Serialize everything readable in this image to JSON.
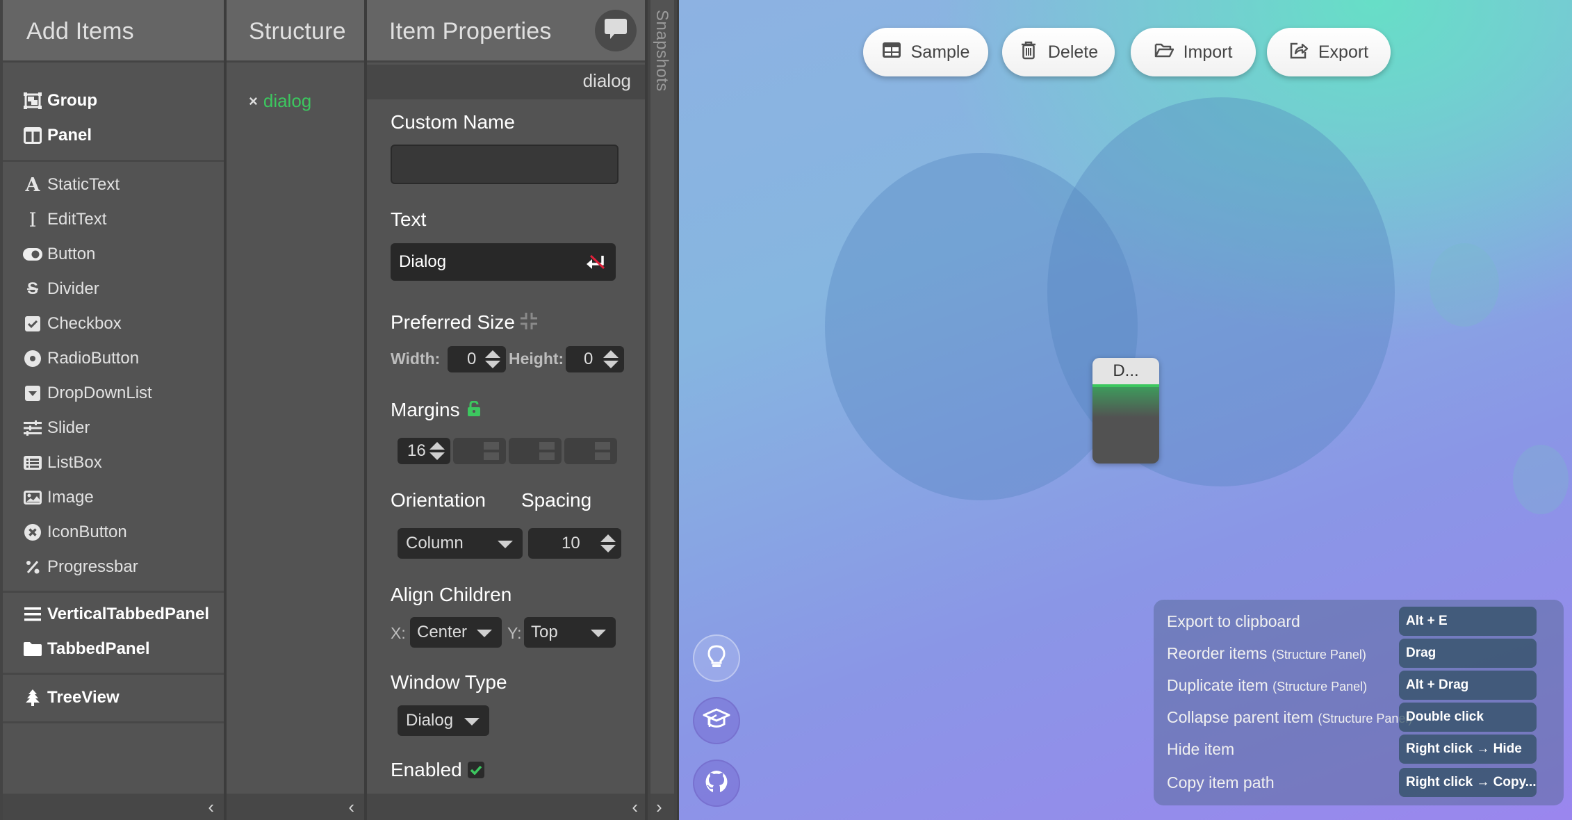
{
  "add_items": {
    "title": "Add Items",
    "groups": [
      [
        {
          "label": "Group",
          "icon": "group-icon",
          "bold": true
        },
        {
          "label": "Panel",
          "icon": "panel-icon",
          "bold": true
        }
      ],
      [
        {
          "label": "StaticText",
          "icon": "static-text-icon",
          "bold": false
        },
        {
          "label": "EditText",
          "icon": "edit-text-icon",
          "bold": false
        },
        {
          "label": "Button",
          "icon": "toggle-icon",
          "bold": false
        },
        {
          "label": "Divider",
          "icon": "strikethrough-icon",
          "bold": false
        },
        {
          "label": "Checkbox",
          "icon": "checkbox-icon",
          "bold": false
        },
        {
          "label": "RadioButton",
          "icon": "radio-icon",
          "bold": false
        },
        {
          "label": "DropDownList",
          "icon": "dropdown-icon",
          "bold": false
        },
        {
          "label": "Slider",
          "icon": "sliders-icon",
          "bold": false
        },
        {
          "label": "ListBox",
          "icon": "list-icon",
          "bold": false
        },
        {
          "label": "Image",
          "icon": "image-icon",
          "bold": false
        },
        {
          "label": "IconButton",
          "icon": "x-circle-icon",
          "bold": false
        },
        {
          "label": "Progressbar",
          "icon": "percent-icon",
          "bold": false
        }
      ],
      [
        {
          "label": "VerticalTabbedPanel",
          "icon": "hamburger-icon",
          "bold": true
        },
        {
          "label": "TabbedPanel",
          "icon": "folder-icon",
          "bold": true
        }
      ],
      [
        {
          "label": "TreeView",
          "icon": "tree-icon",
          "bold": true
        }
      ]
    ],
    "collapse_glyph": "‹"
  },
  "structure": {
    "title": "Structure",
    "items": [
      {
        "remove_glyph": "×",
        "name": "dialog"
      }
    ],
    "collapse_glyph": "‹"
  },
  "properties": {
    "title": "Item Properties",
    "selected_item": "dialog",
    "custom_name": {
      "label": "Custom Name",
      "value": ""
    },
    "text": {
      "label": "Text",
      "value": "Dialog"
    },
    "preferred_size": {
      "label": "Preferred Size",
      "width_label": "Width:",
      "width": "0",
      "height_label": "Height:",
      "height": "0"
    },
    "margins": {
      "label": "Margins",
      "values": [
        "16",
        "",
        "",
        ""
      ],
      "locked": false
    },
    "orientation": {
      "label": "Orientation",
      "value": "Column"
    },
    "spacing": {
      "label": "Spacing",
      "value": "10"
    },
    "align_children": {
      "label": "Align Children",
      "x_label": "X:",
      "x": "Center",
      "y_label": "Y:",
      "y": "Top"
    },
    "window_type": {
      "label": "Window Type",
      "value": "Dialog"
    },
    "enabled": {
      "label": "Enabled",
      "checked": true
    },
    "footer": {
      "left": "‹",
      "right": "›"
    }
  },
  "snapshots": {
    "label": "Snapshots"
  },
  "toolbar": {
    "buttons": [
      {
        "label": "Sample",
        "icon": "table-icon"
      },
      {
        "label": "Delete",
        "icon": "trash-icon"
      },
      {
        "label": "Import",
        "icon": "folder-open-icon"
      },
      {
        "label": "Export",
        "icon": "share-icon"
      }
    ]
  },
  "canvas": {
    "dialog_preview_title": "D..."
  },
  "side_buttons": [
    "lightbulb-icon",
    "graduation-cap-icon",
    "github-icon"
  ],
  "shortcuts": [
    {
      "action": "Export to clipboard",
      "context": "",
      "keys": "Alt + E"
    },
    {
      "action": "Reorder items",
      "context": "(Structure Panel)",
      "keys": "Drag"
    },
    {
      "action": "Duplicate item",
      "context": "(Structure Panel)",
      "keys": "Alt + Drag"
    },
    {
      "action": "Collapse parent item",
      "context": "(Structure Panel)",
      "keys": "Double click"
    },
    {
      "action": "Hide item",
      "context": "",
      "keys": "Right click → Hide"
    },
    {
      "action": "Copy item path",
      "context": "",
      "keys": "Right click → Copy..."
    }
  ],
  "colors": {
    "accent": "#3cc75f",
    "panel_bg": "#535353",
    "header_bg": "#656565"
  }
}
